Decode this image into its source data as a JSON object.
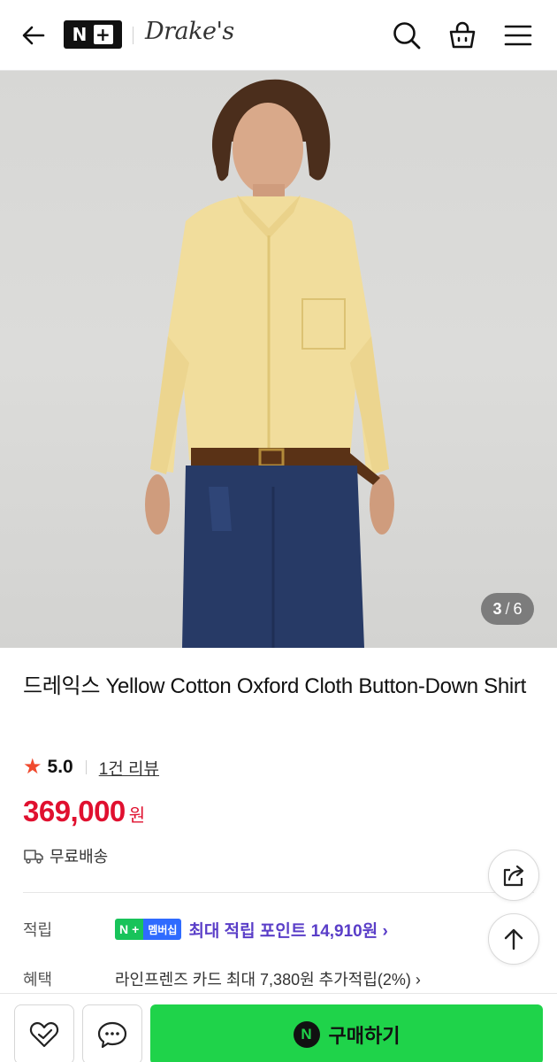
{
  "header": {
    "logo_text": "N",
    "logo_plus": "+",
    "brand": "Drake's",
    "icons": [
      "back-arrow-icon",
      "search-icon",
      "shopping-bag-icon",
      "menu-icon"
    ]
  },
  "gallery": {
    "current": "3",
    "separator": "/",
    "total": "6"
  },
  "product": {
    "title": "드레익스 Yellow Cotton Oxford Cloth Button-Down Shirt",
    "rating": "5.0",
    "review_link": "1건 리뷰",
    "price": "369,000",
    "price_unit": "원",
    "shipping": "무료배송"
  },
  "info": {
    "points_label": "적립",
    "badge_n": "N",
    "badge_plus": "+",
    "badge_text": "멤버십",
    "points_text": "최대 적립 포인트 14,910원 ›",
    "benefit_label": "혜택",
    "benefit_text": "라인프렌즈 카드 최대 7,380원 추가적립(2%) ›"
  },
  "bottom": {
    "buy_icon": "N",
    "buy_label": "구매하기"
  },
  "colors": {
    "price": "#e0102f",
    "buy_button": "#1fd34a",
    "membership_green": "#18c35a",
    "membership_blue": "#2f6bff",
    "points_purple": "#5a3ec8",
    "star": "#f04a2e"
  }
}
